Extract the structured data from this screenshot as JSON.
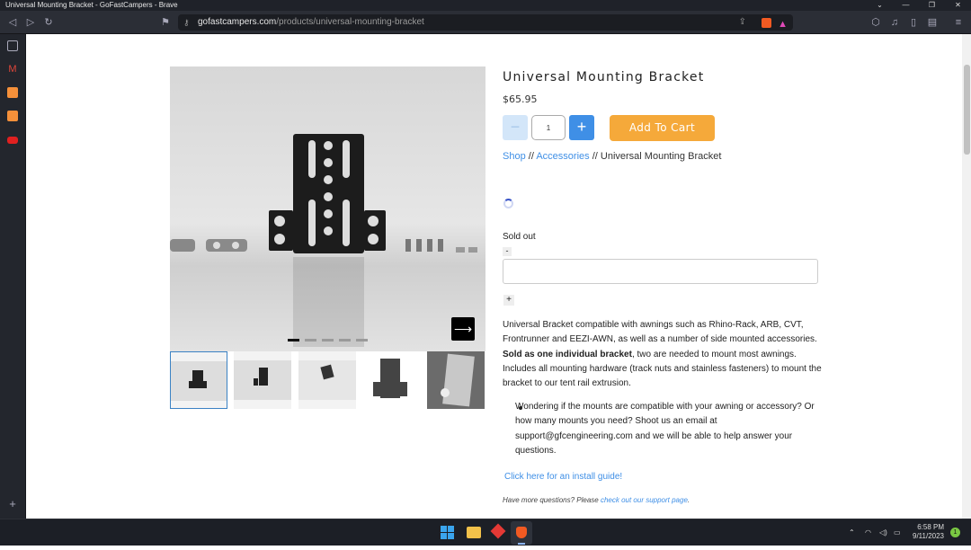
{
  "window": {
    "title": "Universal Mounting Bracket - GoFastCampers - Brave"
  },
  "browser": {
    "url_host": "gofastcampers.com",
    "url_path": "/products/universal-mounting-bracket"
  },
  "product": {
    "title": "Universal Mounting Bracket",
    "price": "$65.95",
    "qty_minus": "−",
    "quantity": "1",
    "qty_plus": "+",
    "add_to_cart": "Add To Cart",
    "breadcrumb": {
      "shop": "Shop",
      "sep": "//",
      "accessories": "Accessories",
      "current": "Universal Mounting Bracket"
    },
    "sold_out": "Sold out",
    "mini_minus": "-",
    "mini_plus": "+",
    "desc_1": "Universal Bracket compatible with awnings such as Rhino-Rack, ARB, CVT, Frontrunner and EEZI-AWN, as well as a number of side mounted accessories. ",
    "desc_bold": "Sold as one individual bracket",
    "desc_2": ", two are needed to mount most awnings. Includes all mounting hardware (track nuts and stainless fasteners) to mount the bracket to our tent rail extrusion.",
    "bullet": "Wondering if the mounts are compatible with your awning or accessory? Or how many mounts you need? Shoot us an email at support@gfcengineering.com and we will be able to help answer your questions.",
    "install_link": "Click here for an install guide!",
    "more_q": "Have more questions? Please ",
    "more_link": "check out our support page",
    "more_end": ".",
    "next_arrow": "⟶",
    "slide_count": 5,
    "active_slide": 1,
    "thumbnails": 5
  },
  "taskbar": {
    "time": "6:58 PM",
    "date": "9/11/2023",
    "notify": "1"
  },
  "colors": {
    "accent": "#3f8fe6",
    "cart": "#f5a93a"
  }
}
